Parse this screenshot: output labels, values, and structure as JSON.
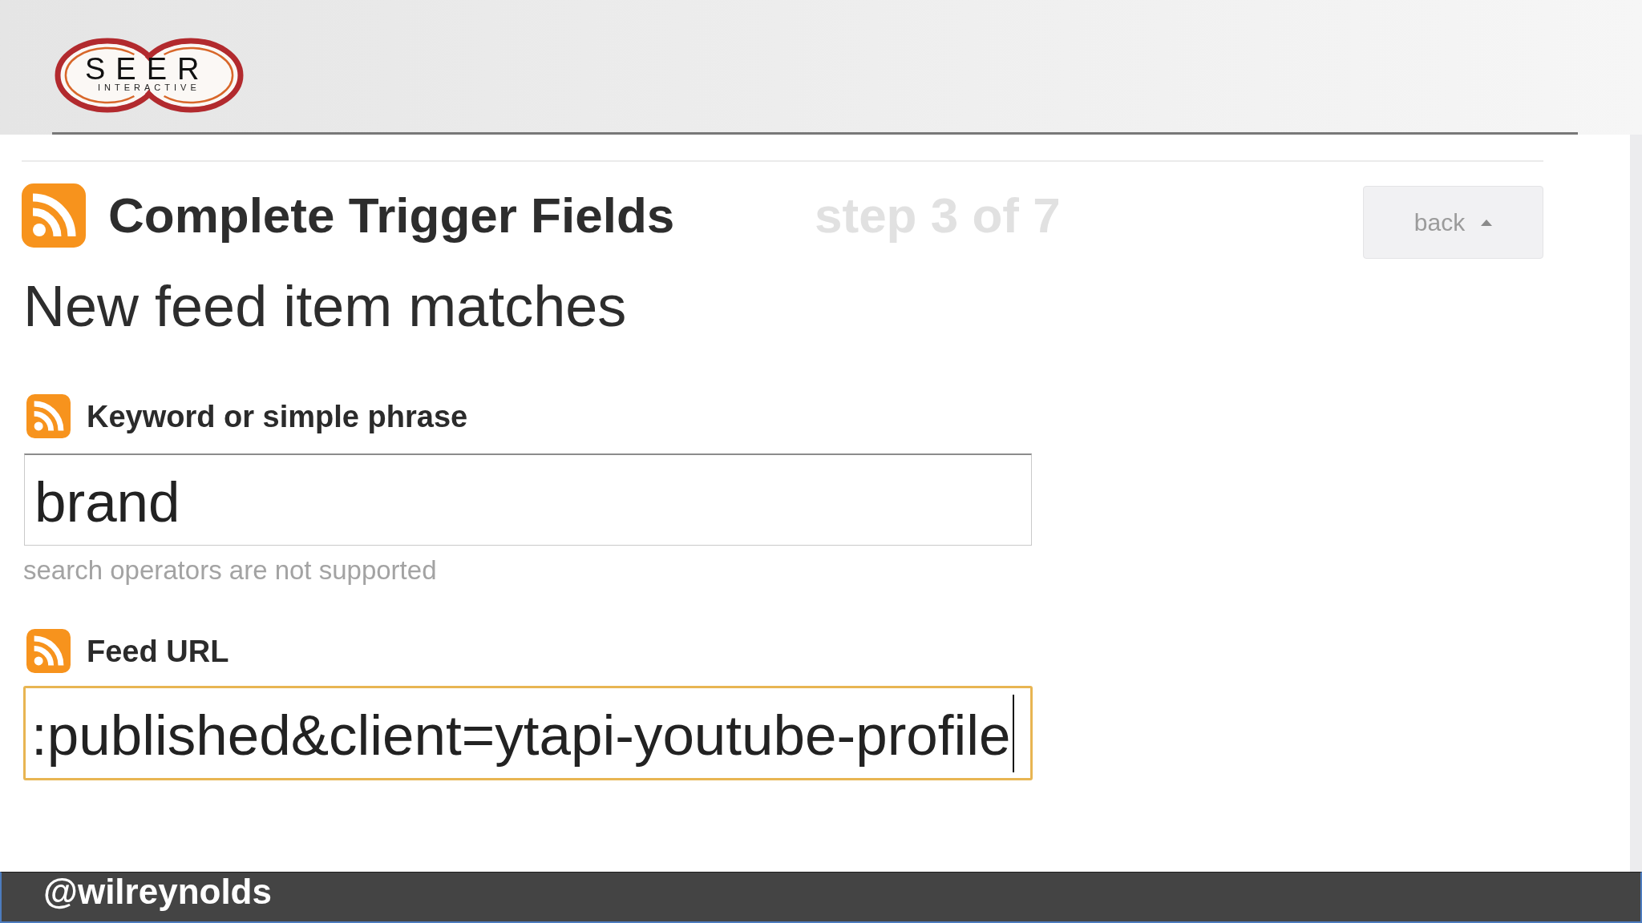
{
  "header": {
    "logo": {
      "wordmark": "SEER",
      "tagline": "INTERACTIVE"
    }
  },
  "step": {
    "title": "Complete Trigger Fields",
    "progress": {
      "label": "step 3 of 7",
      "disabled": true
    },
    "back_button": "back"
  },
  "trigger": {
    "name": "New feed item matches"
  },
  "fields": [
    {
      "label": "Keyword or simple phrase",
      "value": "brand",
      "hint": "search operators are not supported",
      "focused": false
    },
    {
      "label": "Feed URL",
      "value": ":published&client=ytapi-youtube-profile",
      "focused": true
    }
  ],
  "footer": {
    "handle": "@wilreynolds"
  }
}
